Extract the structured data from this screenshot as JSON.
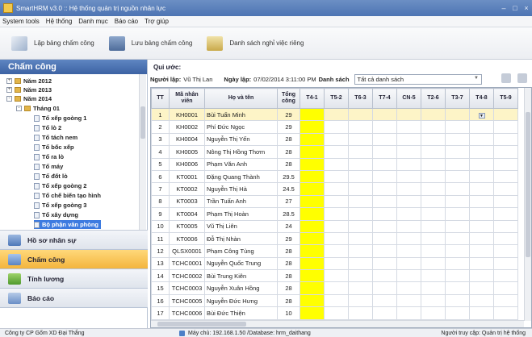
{
  "window": {
    "title": "SmartHRM v3.0 :: Hệ thống quản trị nguồn nhân lực"
  },
  "menu": [
    "System tools",
    "Hệ thống",
    "Danh mục",
    "Báo cáo",
    "Trợ giúp"
  ],
  "toolbar": {
    "create_label": "Lập bảng chấm công",
    "save_label": "Lưu bảng chấm công",
    "leave_label": "Danh sách nghỉ việc riêng"
  },
  "left_panel": {
    "title": "Chấm công",
    "tree": [
      {
        "label": "Năm 2012",
        "exp": "+"
      },
      {
        "label": "Năm 2013",
        "exp": "+"
      },
      {
        "label": "Năm 2014",
        "exp": "-"
      },
      {
        "label": "Tháng 01",
        "exp": "-"
      },
      {
        "label": "Tổ xếp goòng 1"
      },
      {
        "label": "Tổ lò 2"
      },
      {
        "label": "Tổ tách nem"
      },
      {
        "label": "Tổ bốc xếp"
      },
      {
        "label": "Tổ ra lò"
      },
      {
        "label": "Tổ máy"
      },
      {
        "label": "Tổ đốt lò"
      },
      {
        "label": "Tổ xếp goòng 2"
      },
      {
        "label": "Tổ chế biến tạo hình"
      },
      {
        "label": "Tổ xếp goòng 3"
      },
      {
        "label": "Tổ xây dựng"
      },
      {
        "label": "Bộ phận văn phòng"
      }
    ],
    "nav": [
      "Hồ sơ nhân sự",
      "Chấm công",
      "Tính lương",
      "Báo cáo"
    ]
  },
  "filter": {
    "heading": "Qui ước:",
    "creator_label": "Người lập:",
    "creator": "Vũ Thị Lan",
    "date_label": "Ngày lập:",
    "date": "07/02/2014 3:11:00 PM",
    "list_label": "Danh sách",
    "list_value": "Tất cả danh sách"
  },
  "table": {
    "headers": [
      "TT",
      "Mã nhân viên",
      "Họ và tên",
      "Tổng công",
      "T4-1",
      "T5-2",
      "T6-3",
      "T7-4",
      "CN-5",
      "T2-6",
      "T3-7",
      "T4-8",
      "T5-9"
    ],
    "rows": [
      [
        "1",
        "KH0001",
        "Bùi Tuấn Minh",
        "29"
      ],
      [
        "2",
        "KH0002",
        "Phí Đức Ngọc",
        "29"
      ],
      [
        "3",
        "KH0004",
        "Nguyễn Thị Yến",
        "28"
      ],
      [
        "4",
        "KH0005",
        "Nông Thị Hồng Thơm",
        "28"
      ],
      [
        "5",
        "KH0006",
        "Phạm Văn Anh",
        "28"
      ],
      [
        "6",
        "KT0001",
        "Đặng Quang Thành",
        "29.5"
      ],
      [
        "7",
        "KT0002",
        "Nguyễn Thị Hà",
        "24.5"
      ],
      [
        "8",
        "KT0003",
        "Trần Tuấn Anh",
        "27"
      ],
      [
        "9",
        "KT0004",
        "Phạm Thị Hoàn",
        "28.5"
      ],
      [
        "10",
        "KT0005",
        "Vũ Thị Liên",
        "24"
      ],
      [
        "11",
        "KT0006",
        "Đỗ Thị Nhàn",
        "29"
      ],
      [
        "12",
        "QLSX0001",
        "Phạm Công Tùng",
        "28"
      ],
      [
        "13",
        "TCHC0001",
        "Nguyễn Quốc Trung",
        "28"
      ],
      [
        "14",
        "TCHC0002",
        "Bùi Trung Kiên",
        "28"
      ],
      [
        "15",
        "TCHC0003",
        "Nguyễn Xuân Hồng",
        "28"
      ],
      [
        "16",
        "TCHC0005",
        "Nguyễn Đức Hưng",
        "28"
      ],
      [
        "17",
        "TCHC0006",
        "Bùi Đức Thiện",
        "10"
      ]
    ]
  },
  "status": {
    "company": "Công ty CP Gốm XD Đại Thắng",
    "server": "Máy chủ: 192.168.1.50 /Database: hrm_daithang",
    "user": "Người truy cập: Quản trị hệ thống"
  },
  "colors": {
    "accent": "#3c62a3",
    "weekend_fill": "#ffff00",
    "active_nav": "#f3b53d"
  }
}
